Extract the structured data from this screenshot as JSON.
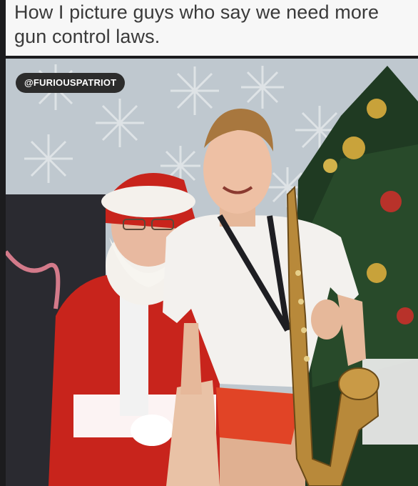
{
  "post": {
    "caption_line1": "How I picture guys who say we need more",
    "caption_line2": "gun control laws.",
    "watermark_handle": "@FURIOUSPATRIOT"
  },
  "colors": {
    "caption_bg": "#f7f7f7",
    "caption_text": "#3a3a3a",
    "backdrop": "#c5cdd3",
    "santa_red": "#c8241c",
    "saxophone_gold": "#b8893a"
  }
}
